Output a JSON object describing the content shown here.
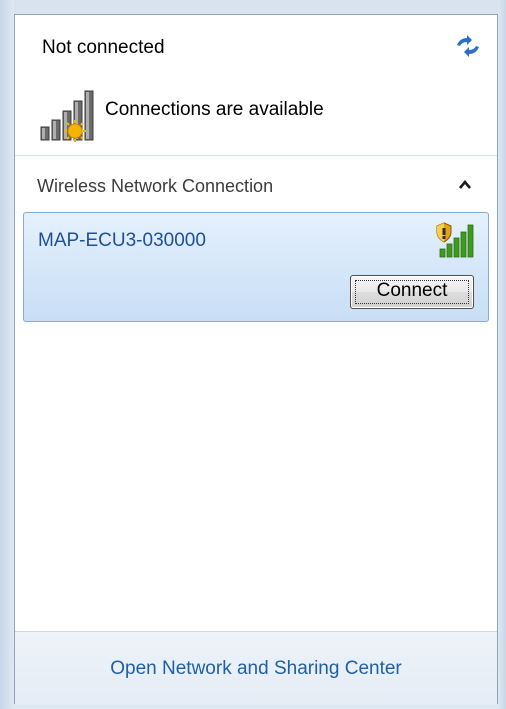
{
  "status": {
    "title": "Not connected",
    "subtitle": "Connections are available"
  },
  "icons": {
    "refresh": "refresh-icon",
    "network_status": "signal-bars-warning-icon",
    "wifi_signal": "wifi-signal-secured-icon",
    "expand": "chevron-up-icon"
  },
  "section": {
    "label": "Wireless Network Connection"
  },
  "networks": [
    {
      "name": "MAP-ECU3-030000",
      "connect_label": "Connect",
      "secured": true,
      "signal_bars": 5
    }
  ],
  "footer": {
    "link_label": "Open Network and Sharing Center"
  },
  "colors": {
    "link": "#1f5fa8",
    "network_name": "#1f4f9a",
    "selection_border": "#84acdd",
    "signal_green": "#4caf2a"
  }
}
